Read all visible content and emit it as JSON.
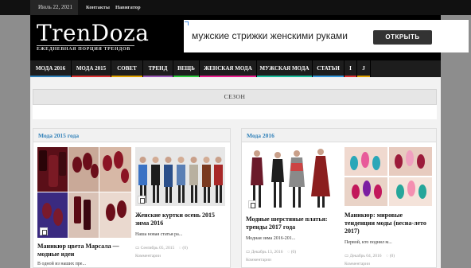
{
  "topbar": {
    "date": "Июль 22, 2021",
    "links": [
      "Контакты",
      "Навигатор"
    ]
  },
  "header": {
    "logo": "TrenDoza",
    "tagline": "ЕЖЕДНЕВНАЯ ПОРЦИЯ ТРЕНДОВ"
  },
  "ad": {
    "text": "мужские стрижки женскими руками",
    "button": "ОТКРЫТЬ"
  },
  "nav": {
    "items": [
      {
        "label": "МОДА 2016",
        "color": "#2e7fb8"
      },
      {
        "label": "МОДА 2015",
        "color": "#d33"
      },
      {
        "label": "СОВЕТ",
        "color": "#e0a000"
      },
      {
        "label": "ТРЕНД",
        "color": "#9b59b6"
      },
      {
        "label": "ВЕЩЬ",
        "color": "#2ecc40"
      },
      {
        "label": "ЖЕНСКАЯ МОДА",
        "color": "#e91e8c"
      },
      {
        "label": "МУЖСКАЯ МОДА",
        "color": "#1abc9c"
      },
      {
        "label": "СТАТЬИ",
        "color": "#3498db"
      },
      {
        "label": "I",
        "color": "#d33"
      },
      {
        "label": "J",
        "color": "#e0a000"
      }
    ]
  },
  "season": "СЕЗОН",
  "panels": [
    {
      "title": "Мода 2015 года",
      "posts": [
        {
          "title": "Маникюр цвета Марсала — модные идеи",
          "excerpt": "В одной из наших пре...",
          "date": "",
          "comments": "",
          "comments_label": ""
        },
        {
          "title": "Женские куртки осень 2015 зима 2016",
          "excerpt": "Наша новая статья ра...",
          "date": "Сентябрь 05, 2015",
          "comments": "(0)",
          "comments_label": "Комментарии"
        }
      ]
    },
    {
      "title": "Мода 2016",
      "posts": [
        {
          "title": "Модные шерстяные платья: тренды 2017 года",
          "excerpt": "Модная зима 2016-201...",
          "date": "Декабрь 13, 2016",
          "comments": "(0)",
          "comments_label": "Комментарии"
        },
        {
          "title": "Маникюр: мировые тенденции моды (весна-лето 2017)",
          "excerpt": "Первой, кто поднял м...",
          "date": "Декабрь 04, 2016",
          "comments": "(0)",
          "comments_label": "Комментарии"
        }
      ]
    }
  ]
}
